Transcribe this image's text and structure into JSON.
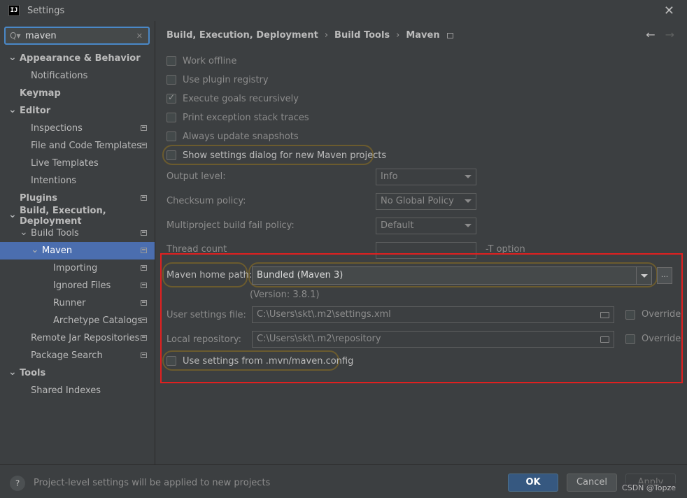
{
  "window": {
    "title": "Settings",
    "app_icon_text": "IJ"
  },
  "search": {
    "value": "maven",
    "icon": "search-icon",
    "clear_icon": "close-icon"
  },
  "tree": [
    {
      "label": "Appearance & Behavior",
      "bold": true,
      "chevron": "v",
      "level": 0
    },
    {
      "label": "Notifications",
      "level": 1
    },
    {
      "label": "Keymap",
      "bold": true,
      "level": 0
    },
    {
      "label": "Editor",
      "bold": true,
      "chevron": "v",
      "level": 0
    },
    {
      "label": "Inspections",
      "level": 1,
      "project": true
    },
    {
      "label": "File and Code Templates",
      "level": 1,
      "project": true
    },
    {
      "label": "Live Templates",
      "level": 1
    },
    {
      "label": "Intentions",
      "level": 1
    },
    {
      "label": "Plugins",
      "bold": true,
      "level": 0,
      "project": true
    },
    {
      "label": "Build, Execution, Deployment",
      "bold": true,
      "chevron": "v",
      "level": 0
    },
    {
      "label": "Build Tools",
      "level": 1,
      "chevron": "v",
      "project": true
    },
    {
      "label": "Maven",
      "level": 2,
      "chevron": "v",
      "project": true,
      "selected": true
    },
    {
      "label": "Importing",
      "level": 3,
      "project": true
    },
    {
      "label": "Ignored Files",
      "level": 3,
      "project": true
    },
    {
      "label": "Runner",
      "level": 3,
      "project": true
    },
    {
      "label": "Archetype Catalogs",
      "level": 3,
      "project": true
    },
    {
      "label": "Remote Jar Repositories",
      "level": 1,
      "project": true
    },
    {
      "label": "Package Search",
      "level": 1,
      "project": true
    },
    {
      "label": "Tools",
      "bold": true,
      "chevron": "v",
      "level": 0
    },
    {
      "label": "Shared Indexes",
      "level": 1
    }
  ],
  "breadcrumb": [
    "Build, Execution, Deployment",
    "Build Tools",
    "Maven"
  ],
  "checkboxes": {
    "work_offline": {
      "label": "Work offline",
      "checked": false
    },
    "plugin_registry": {
      "label": "Use plugin registry",
      "checked": false
    },
    "execute_goals": {
      "label": "Execute goals recursively",
      "checked": true
    },
    "print_exception": {
      "label": "Print exception stack traces",
      "checked": false
    },
    "always_update": {
      "label": "Always update snapshots",
      "checked": false
    },
    "show_settings": {
      "label": "Show settings dialog for new Maven projects",
      "checked": false
    },
    "use_mvn_config": {
      "label": "Use settings from .mvn/maven.config",
      "checked": false
    }
  },
  "fields": {
    "output_level": {
      "label": "Output level:",
      "value": "Info"
    },
    "checksum_policy": {
      "label": "Checksum policy:",
      "value": "No Global Policy"
    },
    "fail_policy": {
      "label": "Multiproject build fail policy:",
      "value": "Default"
    },
    "thread_count": {
      "label": "Thread count",
      "value": "",
      "hint": "-T option"
    },
    "maven_home": {
      "label": "Maven home path:",
      "value": "Bundled (Maven 3)",
      "version": "(Version: 3.8.1)",
      "browse": "..."
    },
    "user_settings": {
      "label": "User settings file:",
      "value": "C:\\Users\\skt\\.m2\\settings.xml",
      "override": "Override"
    },
    "local_repo": {
      "label": "Local repository:",
      "value": "C:\\Users\\skt\\.m2\\repository",
      "override": "Override"
    }
  },
  "footer": {
    "note": "Project-level settings will be applied to new projects",
    "ok": "OK",
    "cancel": "Cancel",
    "apply": "Apply",
    "watermark": "CSDN @Topze"
  },
  "colors": {
    "selection": "#4b6eaf",
    "highlight_border": "#e02020",
    "ok_button": "#365880"
  }
}
